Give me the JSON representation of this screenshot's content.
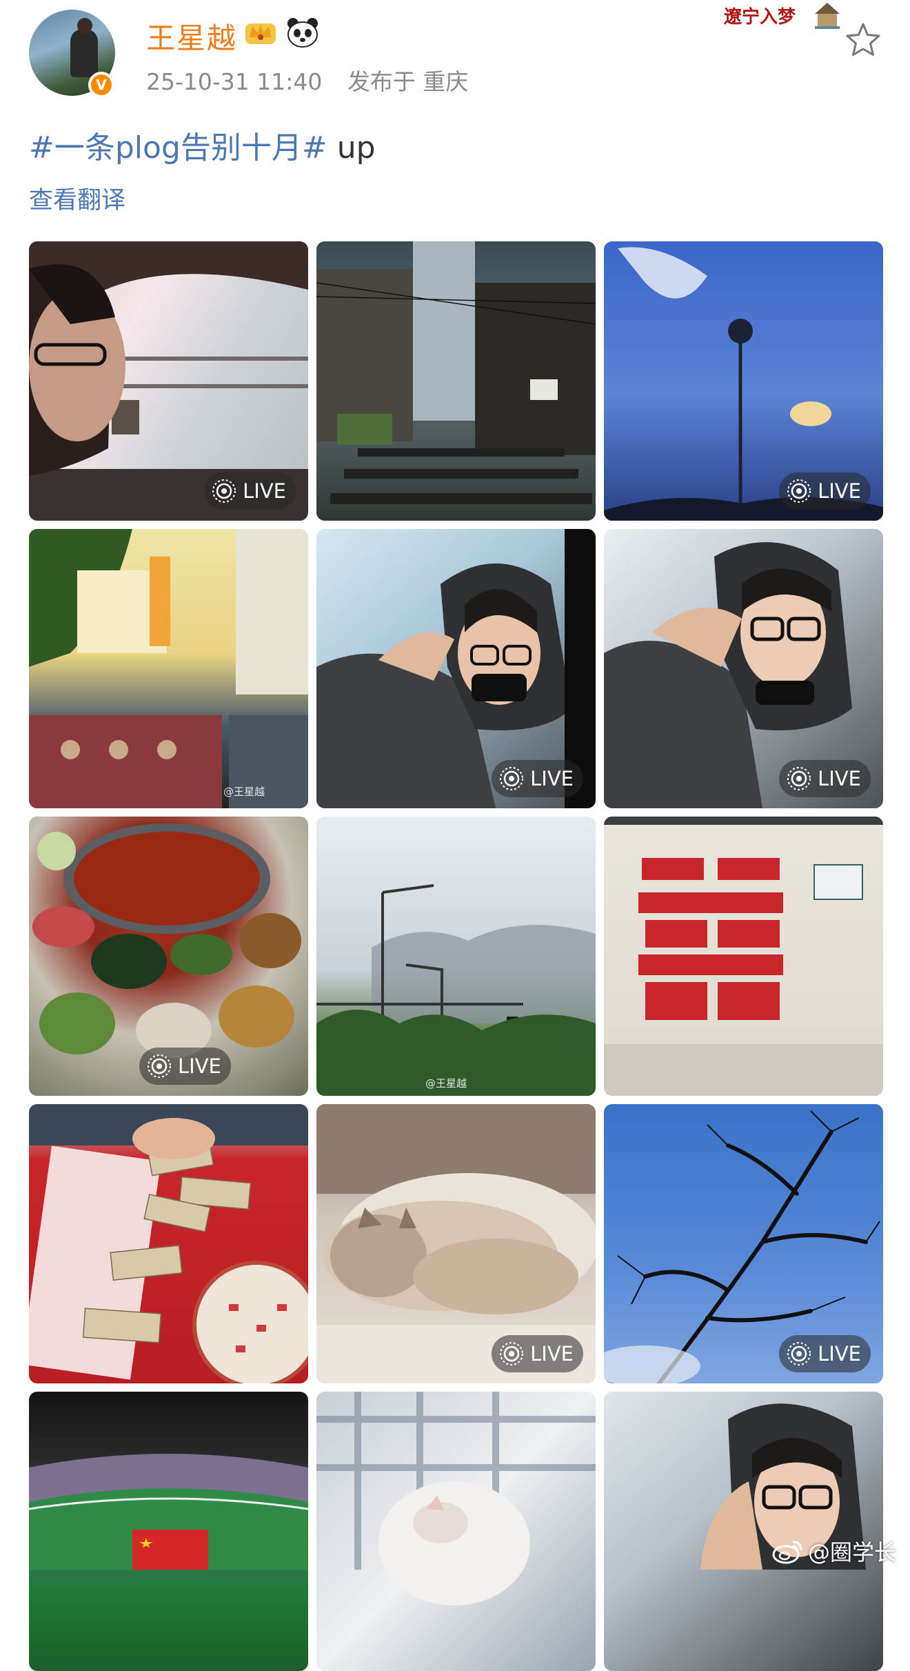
{
  "author": {
    "name": "王星越",
    "verified_mark": "V",
    "timestamp": "25-10-31 11:40",
    "location": "发布于 重庆"
  },
  "header_decoration": {
    "text": "遼宁入梦"
  },
  "post": {
    "hashtag": "#一条plog告别十月#",
    "text_suffix": " up",
    "translate_label": "查看翻译"
  },
  "grid": {
    "live_label": "LIVE",
    "tiles": [
      {
        "scene": "car-window-profile",
        "live": true
      },
      {
        "scene": "old-alley-stairs",
        "live": false
      },
      {
        "scene": "blue-sky-lamp-post",
        "live": true
      },
      {
        "scene": "street-posters",
        "live": false,
        "watermark": "@王星越"
      },
      {
        "scene": "hooded-selfie",
        "live": true
      },
      {
        "scene": "hooded-selfie-glasses",
        "live": true
      },
      {
        "scene": "hotpot-table",
        "live": true
      },
      {
        "scene": "misty-street",
        "live": false,
        "watermark": "@王星越"
      },
      {
        "scene": "red-xi-character",
        "live": false
      },
      {
        "scene": "money-counting",
        "live": false
      },
      {
        "scene": "sleeping-cat",
        "live": true
      },
      {
        "scene": "tree-branches-sky",
        "live": true
      },
      {
        "scene": "stadium-flag",
        "live": false
      },
      {
        "scene": "white-cat-blanket",
        "live": false
      },
      {
        "scene": "selfie-glasses",
        "live": false
      }
    ]
  },
  "footer_watermark": "@圈学长",
  "colors": {
    "username": "#f07d1a",
    "link": "#4c77b5",
    "meta": "#8a8a8a",
    "badge": "#ff8a00"
  }
}
